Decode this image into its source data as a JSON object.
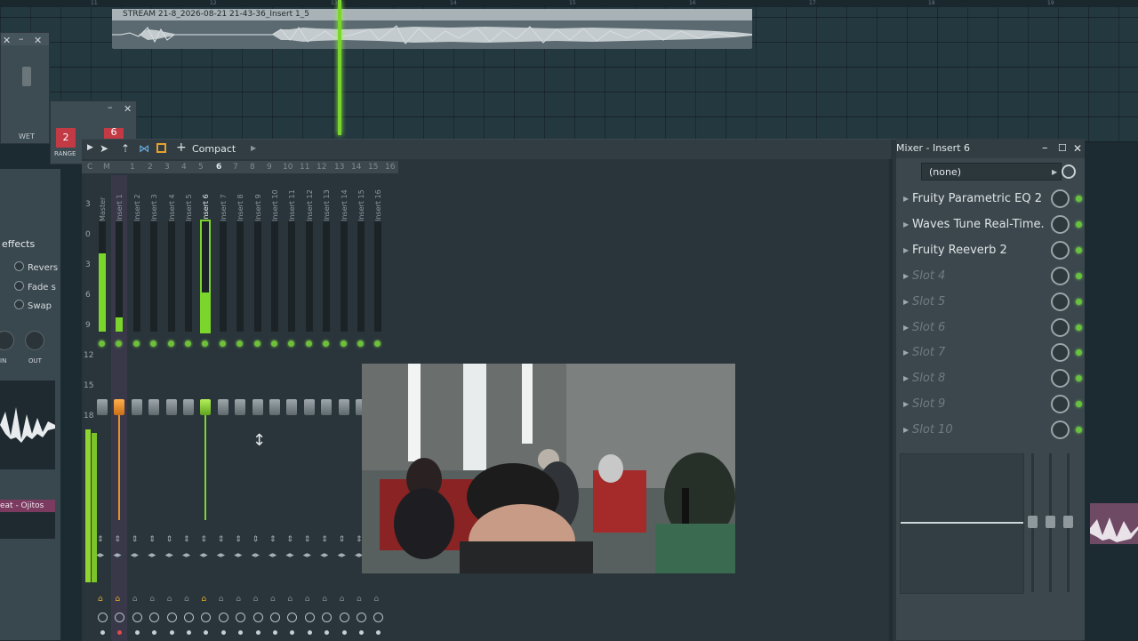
{
  "playlist": {
    "ruler_ticks": [
      "11",
      "12",
      "13",
      "14",
      "15",
      "16",
      "17",
      "18",
      "19"
    ],
    "clip_title": "STREAM 21-8_2026-08-21 21-43-36_Insert 1_5"
  },
  "left_windows": {
    "wet_label": "WET",
    "range_label": "RANGE",
    "range_value_1": "2",
    "range_value_2": "6",
    "effects_title": "effects",
    "effects_items": [
      "Revers",
      "Fade s",
      "Swap"
    ],
    "in_label": "IN",
    "out_label": "OUT",
    "track_label": "eat - Ojitos"
  },
  "mixer": {
    "toolbar_label": "Compact",
    "strip_names": [
      "Master",
      "Insert 1",
      "Insert 2",
      "Insert 3",
      "Insert 4",
      "Insert 5",
      "Insert 6",
      "Insert 7",
      "Insert 8",
      "Insert 9",
      "Insert 10",
      "Insert 11",
      "Insert 12",
      "Insert 13",
      "Insert 14",
      "Insert 15",
      "Insert 16"
    ],
    "header_numbers": [
      "C",
      "M",
      "1",
      "2",
      "3",
      "4",
      "5",
      "6",
      "7",
      "8",
      "9",
      "10",
      "11",
      "12",
      "13",
      "14",
      "15",
      "16"
    ],
    "db_scale": [
      "3",
      "0",
      "3",
      "6",
      "9",
      "12",
      "15",
      "18"
    ]
  },
  "insert_panel": {
    "title": "Mixer - Insert 6",
    "preset": "(none)",
    "slots": [
      {
        "name": "Fruity Parametric EQ 2",
        "empty": false
      },
      {
        "name": "Waves Tune Real-Time...",
        "empty": false
      },
      {
        "name": "Fruity Reeverb 2",
        "empty": false
      },
      {
        "name": "Slot 4",
        "empty": true
      },
      {
        "name": "Slot 5",
        "empty": true
      },
      {
        "name": "Slot 6",
        "empty": true
      },
      {
        "name": "Slot 7",
        "empty": true
      },
      {
        "name": "Slot 8",
        "empty": true
      },
      {
        "name": "Slot 9",
        "empty": true
      },
      {
        "name": "Slot 10",
        "empty": true
      }
    ]
  },
  "colors": {
    "accent_green": "#7bd52a",
    "accent_orange": "#e8912a",
    "slot_text": "#dfe4e6",
    "slot_empty_text": "#6e7b81"
  }
}
